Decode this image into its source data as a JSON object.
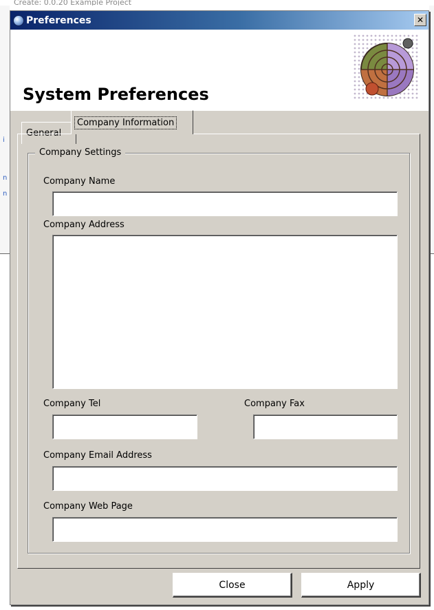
{
  "background": {
    "top_text": "Create:   0.0.20      Example Project"
  },
  "window": {
    "title": "Preferences",
    "close_glyph": "✕"
  },
  "banner": {
    "title": "System Preferences"
  },
  "tabs": [
    {
      "label": "General",
      "selected": false
    },
    {
      "label": "Company Information",
      "selected": true
    }
  ],
  "group": {
    "legend": "Company Settings",
    "fields": {
      "name": {
        "label": "Company Name",
        "value": ""
      },
      "address": {
        "label": "Company Address",
        "value": ""
      },
      "tel": {
        "label": "Company Tel",
        "value": ""
      },
      "fax": {
        "label": "Company Fax",
        "value": ""
      },
      "email": {
        "label": "Company Email Address",
        "value": ""
      },
      "web": {
        "label": "Company Web Page",
        "value": ""
      }
    }
  },
  "buttons": {
    "close": "Close",
    "apply": "Apply"
  },
  "colors": {
    "titlebar_start": "#0a246a",
    "titlebar_end": "#a6caf0",
    "dialog_bg": "#d4d0c8"
  },
  "icons": {
    "window": "globe-icon",
    "banner": "radar-globe-graphic"
  }
}
